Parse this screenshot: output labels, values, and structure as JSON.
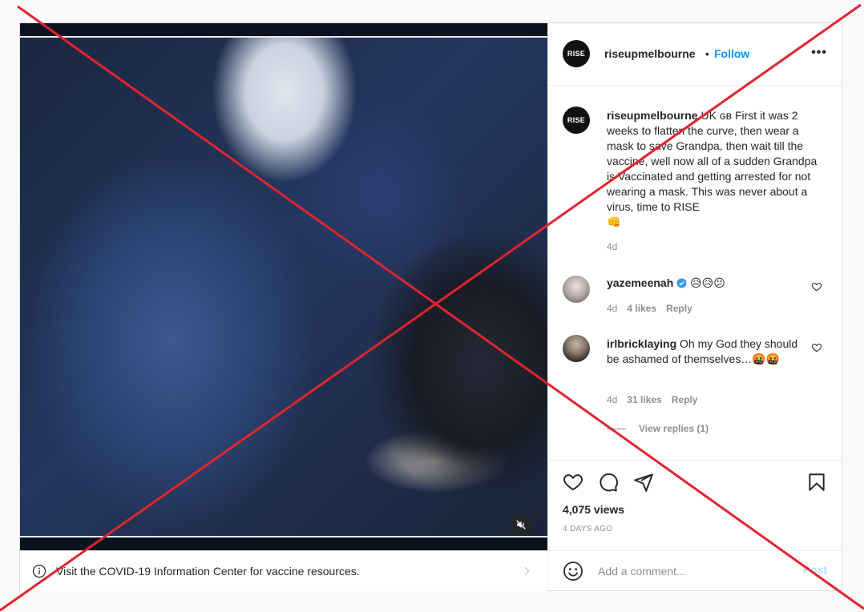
{
  "post": {
    "username": "riseupmelbourne",
    "separator": "•",
    "follow_label": "Follow",
    "more_label": "•••",
    "avatar_text": "RISE",
    "caption": {
      "username": "riseupmelbourne",
      "text": " UK ɢʙ First it was 2 weeks to flatten the curve, then wear a mask to save Grandpa, then wait till the vaccine, well now all of a sudden Grandpa is Vaccinated and getting arrested for not wearing a mask. This was never about a virus, time to RISE",
      "emoji": "👊",
      "time": "4d"
    }
  },
  "comments": [
    {
      "username": "yazemeenah",
      "verified": true,
      "text": " 😥😥😕",
      "time": "4d",
      "likes": "4 likes",
      "reply_label": "Reply"
    },
    {
      "username": "irlbricklaying",
      "verified": false,
      "text": " Oh my God they should be ashamed of themselves…🤬🤬",
      "time": "4d",
      "likes": "31 likes",
      "reply_label": "Reply"
    }
  ],
  "view_replies_label": "View replies (1)",
  "stats": {
    "views": "4,075 views",
    "ago": "4 DAYS AGO"
  },
  "comment_box": {
    "placeholder": "Add a comment...",
    "post_label": "Post"
  },
  "info_bar": {
    "text": "Visit the COVID-19 Information Center for vaccine resources."
  },
  "colors": {
    "follow": "#0095f6",
    "cross": "#e2232e",
    "muted": "#8e8e8e",
    "verified": "#3897f0"
  },
  "icons": [
    "heart-icon",
    "comment-icon",
    "share-icon",
    "bookmark-icon",
    "smile-icon",
    "info-icon",
    "chevron-right-icon",
    "mute-icon",
    "more-icon",
    "verified-icon"
  ]
}
